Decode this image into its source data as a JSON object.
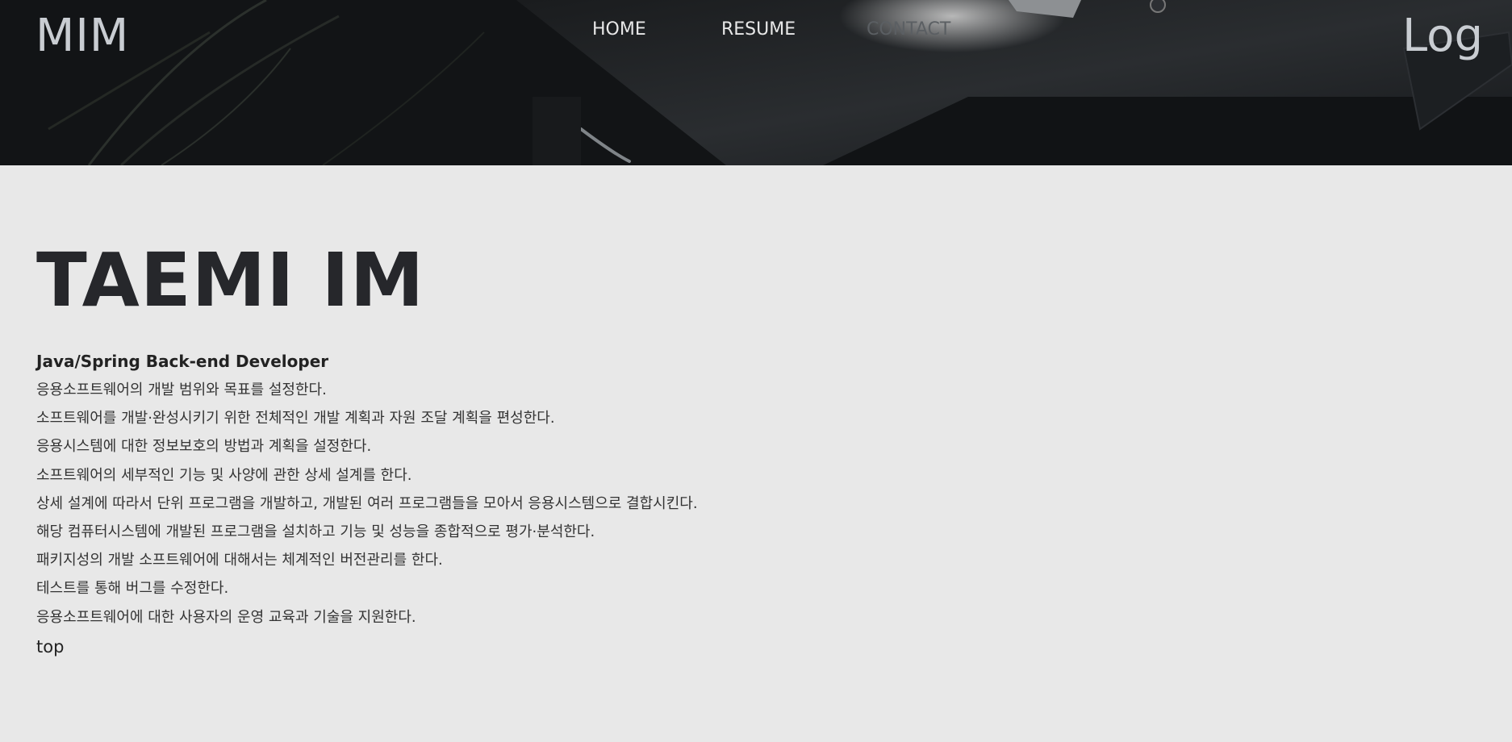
{
  "header": {
    "logo": "MIM",
    "nav": {
      "home": "HOME",
      "resume": "RESUME",
      "contact": "CONTACT"
    },
    "log": "Log"
  },
  "profile": {
    "name": "TAEMI IM",
    "role": "Java/Spring Back-end Developer",
    "duties": [
      "응용소프트웨어의 개발 범위와 목표를 설정한다.",
      "소프트웨어를 개발·완성시키기 위한 전체적인 개발 계획과 자원 조달 계획을 편성한다.",
      "응용시스템에 대한 정보보호의 방법과 계획을 설정한다.",
      "소프트웨어의 세부적인 기능 및 사양에 관한 상세 설계를 한다.",
      "상세 설계에 따라서 단위 프로그램을 개발하고, 개발된 여러 프로그램들을 모아서 응용시스템으로 결합시킨다.",
      "해당 컴퓨터시스템에 개발된 프로그램을 설치하고 기능 및 성능을 종합적으로 평가·분석한다.",
      "패키지성의 개발 소프트웨어에 대해서는 체계적인 버전관리를 한다.",
      "테스트를 통해 버그를 수정한다.",
      "응용소프트웨어에 대한 사용자의 운영 교육과 기술을 지원한다."
    ]
  },
  "footer": {
    "top_link": "top"
  }
}
